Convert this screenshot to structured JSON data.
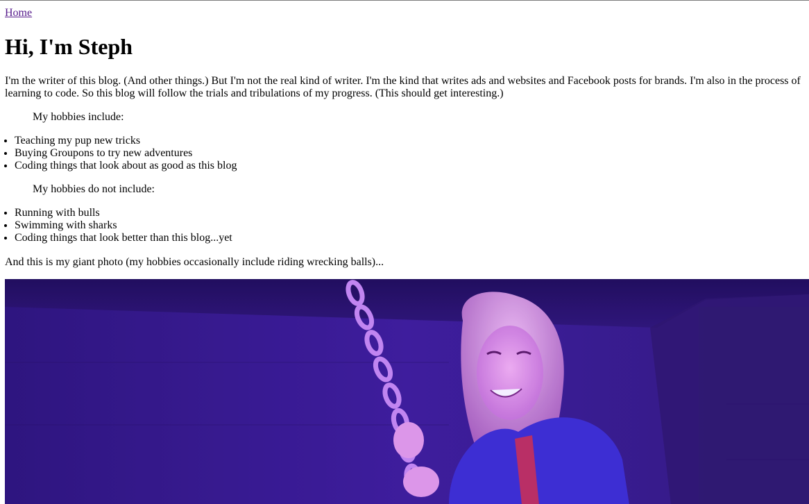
{
  "nav": {
    "home_label": "Home"
  },
  "heading": "Hi, I'm Steph",
  "intro": "I'm the writer of this blog. (And other things.) But I'm not the real kind of writer. I'm the kind that writes ads and websites and Facebook posts for brands. I'm also in the process of learning to code. So this blog will follow the trials and tribulations of my progress. (This should get interesting.)",
  "hobbies": {
    "include_label": "My hobbies include:",
    "include": [
      "Teaching my pup new tricks",
      "Buying Groupons to try new adventures",
      "Coding things that look about as good as this blog"
    ],
    "exclude_label": "My hobbies do not include:",
    "exclude": [
      "Running with bulls",
      "Swimming with sharks",
      "Coding things that look better than this blog...yet"
    ]
  },
  "photo_caption": "And this is my giant photo (my hobbies occasionally include riding wrecking balls)...",
  "photo": {
    "subject": "woman-riding-wrecking-ball-photo",
    "tint": "#3a1a9a"
  }
}
